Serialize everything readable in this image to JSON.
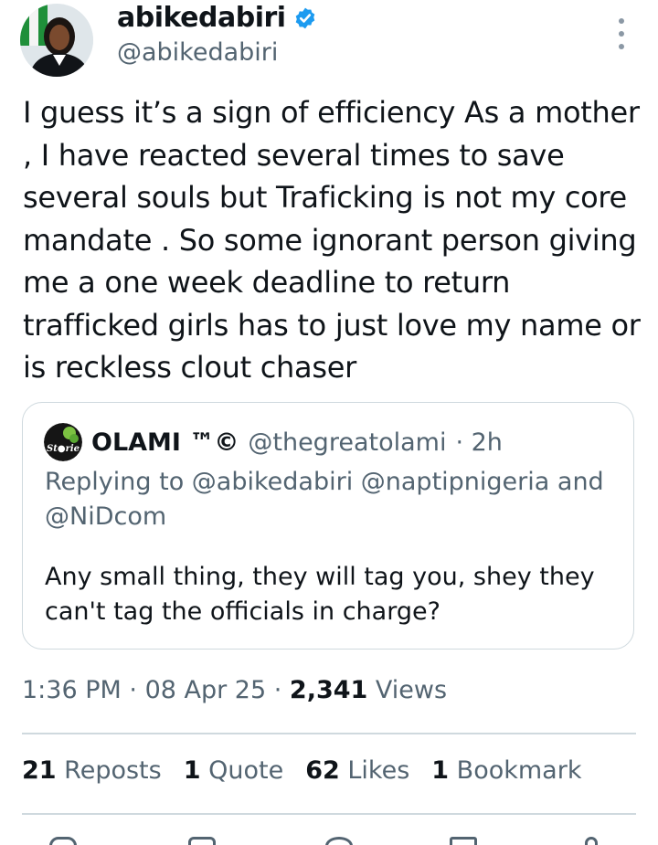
{
  "author": {
    "name": "abikedabiri",
    "handle": "@abikedabiri",
    "verified_color": "#1d9bf0"
  },
  "tweet": {
    "text": "I guess it’s a sign of efficiency As a mother , I have reacted several times to save several souls but Traficking is not my core mandate . So some ignorant person giving me a one week deadline to return trafficked girls has to just love my name or is reckless clout chaser"
  },
  "quote": {
    "name": "OLAMI ™©",
    "handle": "@thegreatolami",
    "time": "· 2h",
    "replying": "Replying to @abikedabiri @naptipnigeria and @NiDcom",
    "text": "Any small thing, they will tag you, shey they can't tag the officials in charge?"
  },
  "meta": {
    "time": "1:36 PM",
    "date": "08 Apr 25",
    "views_count": "2,341",
    "views_label": "Views"
  },
  "stats": {
    "reposts_count": "21",
    "reposts_label": "Reposts",
    "quote_count": "1",
    "quote_label": "Quote",
    "likes_count": "62",
    "likes_label": "Likes",
    "bookmark_count": "1",
    "bookmark_label": "Bookmark"
  },
  "icons": {
    "more": "more-vertical-icon",
    "verified": "verified-badge-icon",
    "reply": "reply-icon",
    "repost": "repost-icon",
    "like": "heart-icon",
    "bookmark": "bookmark-icon",
    "share": "share-icon"
  },
  "colors": {
    "text": "#0f1419",
    "secondary": "#536471",
    "border": "#cfd9de",
    "accent": "#1d9bf0"
  }
}
